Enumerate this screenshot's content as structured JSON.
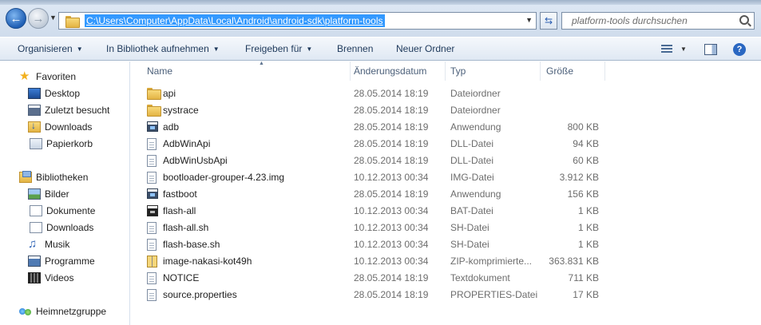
{
  "address": {
    "path": "C:\\Users\\Computer\\AppData\\Local\\Android\\android-sdk\\platform-tools",
    "search_placeholder": "platform-tools durchsuchen"
  },
  "toolbar": {
    "organize": "Organisieren",
    "library": "In Bibliothek aufnehmen",
    "share": "Freigeben für",
    "burn": "Brennen",
    "new_folder": "Neuer Ordner",
    "help": "?"
  },
  "nav": {
    "favorites": {
      "label": "Favoriten",
      "items": [
        "Desktop",
        "Zuletzt besucht",
        "Downloads",
        "Papierkorb"
      ]
    },
    "libraries": {
      "label": "Bibliotheken",
      "items": [
        "Bilder",
        "Dokumente",
        "Downloads",
        "Musik",
        "Programme",
        "Videos"
      ]
    },
    "homegroup": "Heimnetzgruppe"
  },
  "columns": {
    "name": "Name",
    "date": "Änderungsdatum",
    "type": "Typ",
    "size": "Größe"
  },
  "files": [
    {
      "name": "api",
      "date": "28.05.2014 18:19",
      "type": "Dateiordner",
      "size": "",
      "icon": "folder-icon"
    },
    {
      "name": "systrace",
      "date": "28.05.2014 18:19",
      "type": "Dateiordner",
      "size": "",
      "icon": "folder-icon"
    },
    {
      "name": "adb",
      "date": "28.05.2014 18:19",
      "type": "Anwendung",
      "size": "800 KB",
      "icon": "application-icon"
    },
    {
      "name": "AdbWinApi",
      "date": "28.05.2014 18:19",
      "type": "DLL-Datei",
      "size": "94 KB",
      "icon": "dll-icon"
    },
    {
      "name": "AdbWinUsbApi",
      "date": "28.05.2014 18:19",
      "type": "DLL-Datei",
      "size": "60 KB",
      "icon": "dll-icon"
    },
    {
      "name": "bootloader-grouper-4.23.img",
      "date": "10.12.2013 00:34",
      "type": "IMG-Datei",
      "size": "3.912 KB",
      "icon": "file-icon"
    },
    {
      "name": "fastboot",
      "date": "28.05.2014 18:19",
      "type": "Anwendung",
      "size": "156 KB",
      "icon": "application-icon"
    },
    {
      "name": "flash-all",
      "date": "10.12.2013 00:34",
      "type": "BAT-Datei",
      "size": "1 KB",
      "icon": "batch-icon"
    },
    {
      "name": "flash-all.sh",
      "date": "10.12.2013 00:34",
      "type": "SH-Datei",
      "size": "1 KB",
      "icon": "file-icon"
    },
    {
      "name": "flash-base.sh",
      "date": "10.12.2013 00:34",
      "type": "SH-Datei",
      "size": "1 KB",
      "icon": "file-icon"
    },
    {
      "name": "image-nakasi-kot49h",
      "date": "10.12.2013 00:34",
      "type": "ZIP-komprimierte...",
      "size": "363.831 KB",
      "icon": "zip-icon"
    },
    {
      "name": "NOTICE",
      "date": "28.05.2014 18:19",
      "type": "Textdokument",
      "size": "711 KB",
      "icon": "text-file-icon"
    },
    {
      "name": "source.properties",
      "date": "28.05.2014 18:19",
      "type": "PROPERTIES-Datei",
      "size": "17 KB",
      "icon": "file-icon"
    }
  ]
}
